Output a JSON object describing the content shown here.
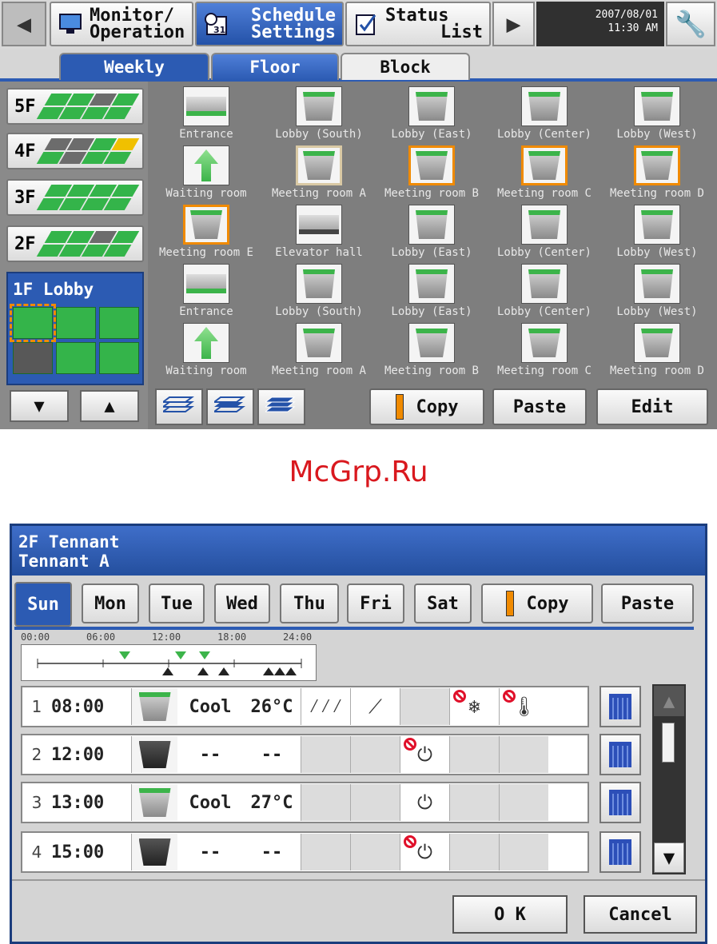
{
  "header": {
    "nav": [
      {
        "label_l1": "Monitor/",
        "label_l2": "Operation"
      },
      {
        "label_l1": "Schedule",
        "label_l2": "Settings"
      },
      {
        "label_l1": "Status",
        "label_l2": "List"
      }
    ],
    "date": "2007/08/01",
    "time": "11:30 AM",
    "calendar_icon_text": "31"
  },
  "tabs": [
    "Weekly",
    "Floor",
    "Block"
  ],
  "floors": [
    "5F",
    "4F",
    "3F",
    "2F"
  ],
  "lobby": {
    "label": "1F Lobby"
  },
  "units": [
    [
      "Entrance",
      "Lobby (South)",
      "Lobby (East)",
      "Lobby (Center)",
      "Lobby (West)"
    ],
    [
      "Waiting room",
      "Meeting room A",
      "Meeting room B",
      "Meeting room C",
      "Meeting room D"
    ],
    [
      "Meeting room E",
      "Elevator hall",
      "Lobby (East)",
      "Lobby (Center)",
      "Lobby (West)"
    ],
    [
      "Entrance",
      "Lobby (South)",
      "Lobby (East)",
      "Lobby (Center)",
      "Lobby (West)"
    ],
    [
      "Waiting room",
      "Meeting room A",
      "Meeting room B",
      "Meeting room C",
      "Meeting room D"
    ]
  ],
  "actions": {
    "copy": "Copy",
    "paste": "Paste",
    "edit": "Edit"
  },
  "watermark": "McGrp.Ru",
  "dialog": {
    "title_l1": "2F Tennant",
    "title_l2": "Tennant A",
    "days": [
      "Sun",
      "Mon",
      "Tue",
      "Wed",
      "Thu",
      "Fri",
      "Sat"
    ],
    "copy": "Copy",
    "paste": "Paste",
    "timeline_labels": [
      "00:00",
      "06:00",
      "12:00",
      "18:00",
      "24:00"
    ],
    "events": [
      {
        "num": "1",
        "time": "08:00",
        "mode": "Cool",
        "temp": "26°C"
      },
      {
        "num": "2",
        "time": "12:00",
        "mode": "--",
        "temp": "--"
      },
      {
        "num": "3",
        "time": "13:00",
        "mode": "Cool",
        "temp": "27°C"
      },
      {
        "num": "4",
        "time": "15:00",
        "mode": "--",
        "temp": "--"
      }
    ],
    "ok": "O K",
    "cancel": "Cancel"
  },
  "colors": {
    "accent": "#2c5bb3",
    "green": "#34b44a",
    "selection": "#f08a00",
    "forbid": "#e0102a"
  }
}
